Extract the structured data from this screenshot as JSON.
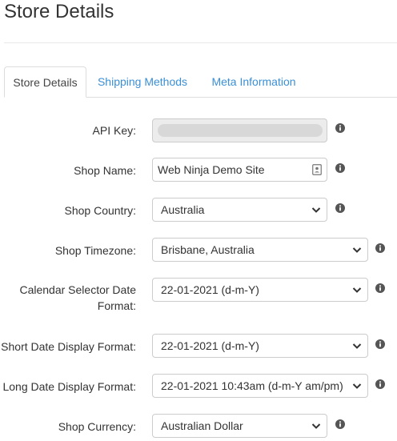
{
  "page": {
    "title": "Store Details"
  },
  "tabs": [
    {
      "label": "Store Details",
      "active": true
    },
    {
      "label": "Shipping Methods",
      "active": false
    },
    {
      "label": "Meta Information",
      "active": false
    }
  ],
  "form": {
    "api_key": {
      "label": "API Key:",
      "value": ""
    },
    "shop_name": {
      "label": "Shop Name:",
      "value": "Web Ninja Demo Site"
    },
    "shop_country": {
      "label": "Shop Country:",
      "value": "Australia"
    },
    "shop_timezone": {
      "label": "Shop Timezone:",
      "value": "Brisbane, Australia"
    },
    "calendar_format": {
      "label_line1": "Calendar Selector Date",
      "label_line2": "Format:",
      "value": "22-01-2021 (d-m-Y)"
    },
    "short_date_format": {
      "label": "Short Date Display Format:",
      "value": "22-01-2021 (d-m-Y)"
    },
    "long_date_format": {
      "label": "Long Date Display Format:",
      "value": "22-01-2021 10:43am (d-m-Y am/pm)"
    },
    "shop_currency": {
      "label": "Shop Currency:",
      "value": "Australian Dollar"
    }
  },
  "colors": {
    "link": "#3a8fd6",
    "border": "#cccccc",
    "icon": "#555555"
  },
  "icons": {
    "info": "info-circle-icon",
    "chevron": "chevron-down-icon",
    "contact": "contact-card-icon"
  }
}
